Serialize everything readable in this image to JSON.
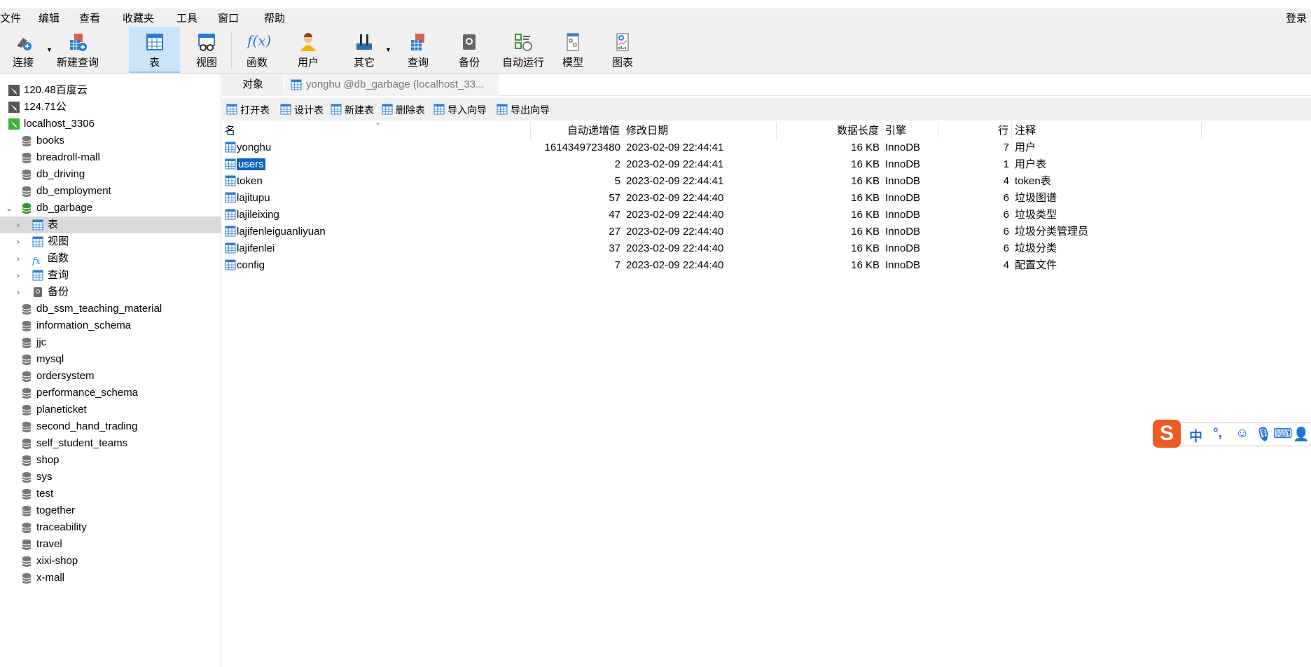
{
  "menu": [
    "文件",
    "编辑",
    "查看",
    "收藏夹",
    "工具",
    "窗口",
    "帮助"
  ],
  "login": "登录",
  "toolbar": {
    "connect": "连接",
    "new_query": "新建查询",
    "table": "表",
    "view": "视图",
    "function": "函数",
    "user": "用户",
    "other": "其它",
    "query": "查询",
    "backup": "备份",
    "auto_run": "自动运行",
    "model": "模型",
    "chart": "图表"
  },
  "sidebar": {
    "connections": [
      "120.48百度云",
      "124.71公",
      "localhost_3306"
    ],
    "databases_before": [
      "books",
      "breadroll-mall",
      "db_driving",
      "db_employment",
      "db_garbage"
    ],
    "garbage_children": [
      "表",
      "视图",
      "函数",
      "查询",
      "备份"
    ],
    "databases_after": [
      "db_ssm_teaching_material",
      "information_schema",
      "jjc",
      "mysql",
      "ordersystem",
      "performance_schema",
      "planeticket",
      "second_hand_trading",
      "self_student_teams",
      "shop",
      "sys",
      "test",
      "together",
      "traceability",
      "travel",
      "xixi-shop",
      "x-mall"
    ]
  },
  "tabs": {
    "objects": "对象",
    "doc": "yonghu @db_garbage (localhost_33..."
  },
  "actions": [
    "打开表",
    "设计表",
    "新建表",
    "删除表",
    "导入向导",
    "导出向导"
  ],
  "columns": [
    "名",
    "自动递增值",
    "修改日期",
    "数据长度",
    "引擎",
    "行",
    "注释"
  ],
  "rows": [
    [
      "yonghu",
      "1614349723480",
      "2023-02-09 22:44:41",
      "16 KB",
      "InnoDB",
      "7",
      "用户"
    ],
    [
      "users",
      "2",
      "2023-02-09 22:44:41",
      "16 KB",
      "InnoDB",
      "1",
      "用户表"
    ],
    [
      "token",
      "5",
      "2023-02-09 22:44:41",
      "16 KB",
      "InnoDB",
      "4",
      "token表"
    ],
    [
      "lajitupu",
      "57",
      "2023-02-09 22:44:40",
      "16 KB",
      "InnoDB",
      "6",
      "垃圾图谱"
    ],
    [
      "lajileixing",
      "47",
      "2023-02-09 22:44:40",
      "16 KB",
      "InnoDB",
      "6",
      "垃圾类型"
    ],
    [
      "lajifenleiguanliyuan",
      "27",
      "2023-02-09 22:44:40",
      "16 KB",
      "InnoDB",
      "6",
      "垃圾分类管理员"
    ],
    [
      "lajifenlei",
      "37",
      "2023-02-09 22:44:40",
      "16 KB",
      "InnoDB",
      "6",
      "垃圾分类"
    ],
    [
      "config",
      "7",
      "2023-02-09 22:44:40",
      "16 KB",
      "InnoDB",
      "4",
      "配置文件"
    ]
  ],
  "ime": {
    "mode": "中",
    "punct": "°,"
  },
  "colors": {
    "selection": "#0a64c8",
    "active_tool": "#cce4f7",
    "sidebar_selected": "#d9d9d9"
  }
}
